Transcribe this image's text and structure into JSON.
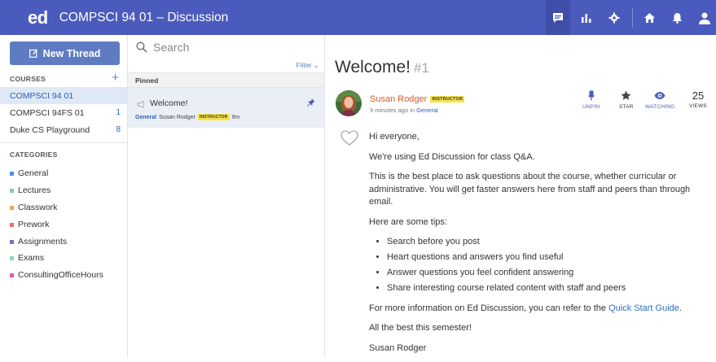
{
  "app": {
    "logo": "ed",
    "course_title": "COMPSCI 94 01 – Discussion",
    "top_icons": [
      "discussion-icon",
      "analytics-icon",
      "settings-icon",
      "home-icon",
      "bell-icon",
      "user-icon"
    ]
  },
  "sidebar": {
    "new_thread_label": "New Thread",
    "courses_heading": "COURSES",
    "courses": [
      {
        "name": "COMPSCI 94 01",
        "badge": ""
      },
      {
        "name": "COMPSCI 94FS 01",
        "badge": "1"
      },
      {
        "name": "Duke CS Playground",
        "badge": "8"
      }
    ],
    "categories_heading": "CATEGORIES",
    "categories": [
      {
        "name": "General",
        "color": "#4f8fe0"
      },
      {
        "name": "Lectures",
        "color": "#85d0a5"
      },
      {
        "name": "Classwork",
        "color": "#f0a55c"
      },
      {
        "name": "Prework",
        "color": "#e8706e"
      },
      {
        "name": "Assignments",
        "color": "#7c6fb8"
      },
      {
        "name": "Exams",
        "color": "#8fd6c4"
      },
      {
        "name": "ConsultingOfficeHours",
        "color": "#e05fa0"
      }
    ]
  },
  "threadlist": {
    "search_placeholder": "Search",
    "filter_label": "Filter",
    "pinned_label": "Pinned",
    "threads": [
      {
        "title": "Welcome!",
        "category": "General",
        "author": "Susan Rodger",
        "role": "INSTRUCTOR",
        "time": "9m"
      }
    ]
  },
  "post": {
    "title": "Welcome!",
    "number": "#1",
    "author": "Susan Rodger",
    "role": "INSTRUCTOR",
    "time_text": "9 minutes ago in",
    "category": "General",
    "actions": {
      "unpin": "UNPIN",
      "star": "STAR",
      "watching": "WATCHING",
      "views_count": "25",
      "views_label": "VIEWS"
    },
    "body": {
      "greeting": "Hi everyone,",
      "p1": "We're using Ed Discussion for class Q&A.",
      "p2": "This is the best place to ask questions about the course, whether curricular or administrative. You will get faster answers here from staff and peers than through email.",
      "p3": "Here are some tips:",
      "tips": [
        "Search before you post",
        "Heart questions and answers you find useful",
        "Answer questions you feel confident answering",
        "Share interesting course related content with staff and peers"
      ],
      "p4_prefix": "For more information on Ed Discussion, you can refer to the ",
      "p4_link": "Quick Start Guide",
      "p4_suffix": ".",
      "p5": "All the best this semester!",
      "signature": "Susan Rodger"
    }
  },
  "colors": {
    "topbar": "#4b5bbd",
    "accent": "#5f7cc3",
    "author": "#d25a2b",
    "instructor_tag": "#f5e44b"
  }
}
